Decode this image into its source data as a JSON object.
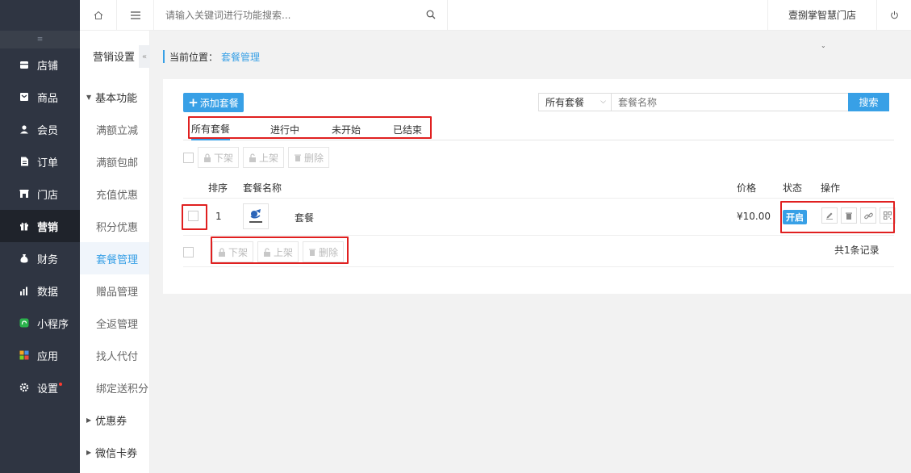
{
  "colors": {
    "accent": "#38a0e6",
    "nav_bg": "#2f3542",
    "highlight_box": "#e02020"
  },
  "topbar": {
    "search_placeholder": "请输入关键词进行功能搜索...",
    "shop_name": "壹捌掌智慧门店"
  },
  "nav": {
    "collapse_icon": "≡",
    "items": [
      {
        "label": "店铺",
        "icon": "store-icon"
      },
      {
        "label": "商品",
        "icon": "goods-icon"
      },
      {
        "label": "会员",
        "icon": "member-icon"
      },
      {
        "label": "订单",
        "icon": "order-icon"
      },
      {
        "label": "门店",
        "icon": "shop-icon"
      },
      {
        "label": "营销",
        "icon": "gift-icon",
        "active": true
      },
      {
        "label": "财务",
        "icon": "money-bag-icon"
      },
      {
        "label": "数据",
        "icon": "bar-chart-icon"
      },
      {
        "label": "小程序",
        "icon": "mini-program-icon"
      },
      {
        "label": "应用",
        "icon": "apps-icon"
      },
      {
        "label": "设置",
        "icon": "gear-icon"
      }
    ]
  },
  "submenu": {
    "title": "营销设置",
    "group_basic": "基本功能",
    "items": [
      "满额立减",
      "满额包邮",
      "充值优惠",
      "积分优惠",
      "套餐管理",
      "赠品管理",
      "全返管理",
      "找人代付",
      "绑定送积分"
    ],
    "active_index": 4,
    "group_coupon": "优惠券",
    "group_wechat": "微信卡券"
  },
  "breadcrumb": {
    "label": "当前位置：",
    "current": "套餐管理"
  },
  "toolbar": {
    "add_label": "添加套餐",
    "filter_value": "所有套餐",
    "name_placeholder": "套餐名称",
    "search_label": "搜索"
  },
  "tabs": [
    "所有套餐",
    "进行中",
    "未开始",
    "已结束"
  ],
  "bulk": {
    "down": "下架",
    "up": "上架",
    "delete": "删除"
  },
  "table": {
    "headers": {
      "order": "排序",
      "name": "套餐名称",
      "price": "价格",
      "status": "状态",
      "ops": "操作"
    },
    "rows": [
      {
        "order": "1",
        "name": "套餐",
        "price": "¥10.00",
        "status": "开启"
      }
    ]
  },
  "records": "共1条记录"
}
